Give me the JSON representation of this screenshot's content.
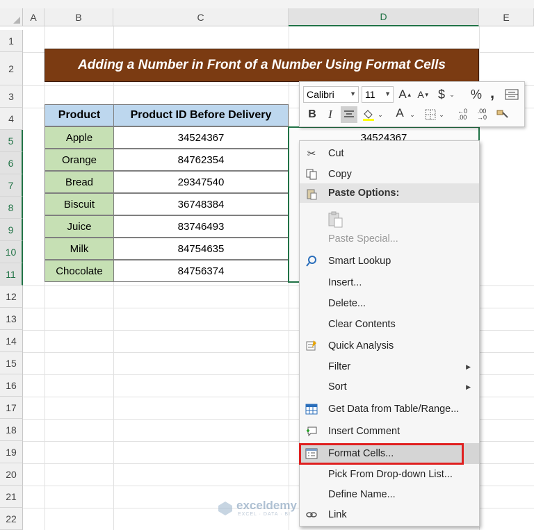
{
  "columns": [
    "A",
    "B",
    "C",
    "D",
    "E"
  ],
  "rows": [
    "1",
    "2",
    "3",
    "4",
    "5",
    "6",
    "7",
    "8",
    "9",
    "10",
    "11",
    "12",
    "13",
    "14",
    "15",
    "16",
    "17",
    "18",
    "19",
    "20",
    "21",
    "22"
  ],
  "title": "Adding a Number in Front of a Number Using Format Cells",
  "table": {
    "headers": [
      "Product",
      "Product ID Before Delivery"
    ],
    "rows": [
      {
        "product": "Apple",
        "id": "34524367"
      },
      {
        "product": "Orange",
        "id": "84762354"
      },
      {
        "product": "Bread",
        "id": "29347540"
      },
      {
        "product": "Biscuit",
        "id": "36748384"
      },
      {
        "product": "Juice",
        "id": "83746493"
      },
      {
        "product": "Milk",
        "id": "84754635"
      },
      {
        "product": "Chocolate",
        "id": "84756374"
      }
    ]
  },
  "selected_cell_value": "34524367",
  "mini_toolbar": {
    "font": "Calibri",
    "size": "11",
    "increase_font_label": "A",
    "decrease_font_label": "A",
    "currency_label": "$",
    "percent_label": "%",
    "comma_label": ",",
    "bold_label": "B",
    "italic_label": "I",
    "font_color_label": "A"
  },
  "context_menu": {
    "items": [
      {
        "label": "Cut",
        "icon": "scissors-icon"
      },
      {
        "label": "Copy",
        "icon": "copy-icon"
      },
      {
        "label": "Paste Options:",
        "icon": "paste-icon"
      },
      {
        "label": "",
        "icon": "clipboard-icon"
      },
      {
        "label": "Paste Special...",
        "icon": ""
      },
      {
        "label": "Smart Lookup",
        "icon": "smart-lookup-icon"
      },
      {
        "label": "Insert...",
        "icon": ""
      },
      {
        "label": "Delete...",
        "icon": ""
      },
      {
        "label": "Clear Contents",
        "icon": ""
      },
      {
        "label": "Quick Analysis",
        "icon": "quick-analysis-icon"
      },
      {
        "label": "Filter",
        "icon": ""
      },
      {
        "label": "Sort",
        "icon": ""
      },
      {
        "label": "Get Data from Table/Range...",
        "icon": "table-icon"
      },
      {
        "label": "Insert Comment",
        "icon": "comment-icon"
      },
      {
        "label": "Format Cells...",
        "icon": "format-cells-icon"
      },
      {
        "label": "Pick From Drop-down List...",
        "icon": ""
      },
      {
        "label": "Define Name...",
        "icon": ""
      },
      {
        "label": "Link",
        "icon": "link-icon"
      }
    ]
  },
  "watermark": {
    "name": "exceldemy",
    "tagline": "EXCEL · DATA · BI"
  },
  "colors": {
    "title_bg": "#7b3b12",
    "header_bg": "#bdd7ee",
    "product_bg": "#c6e0b4",
    "selection": "#217346",
    "highlight_box": "#e02020"
  }
}
